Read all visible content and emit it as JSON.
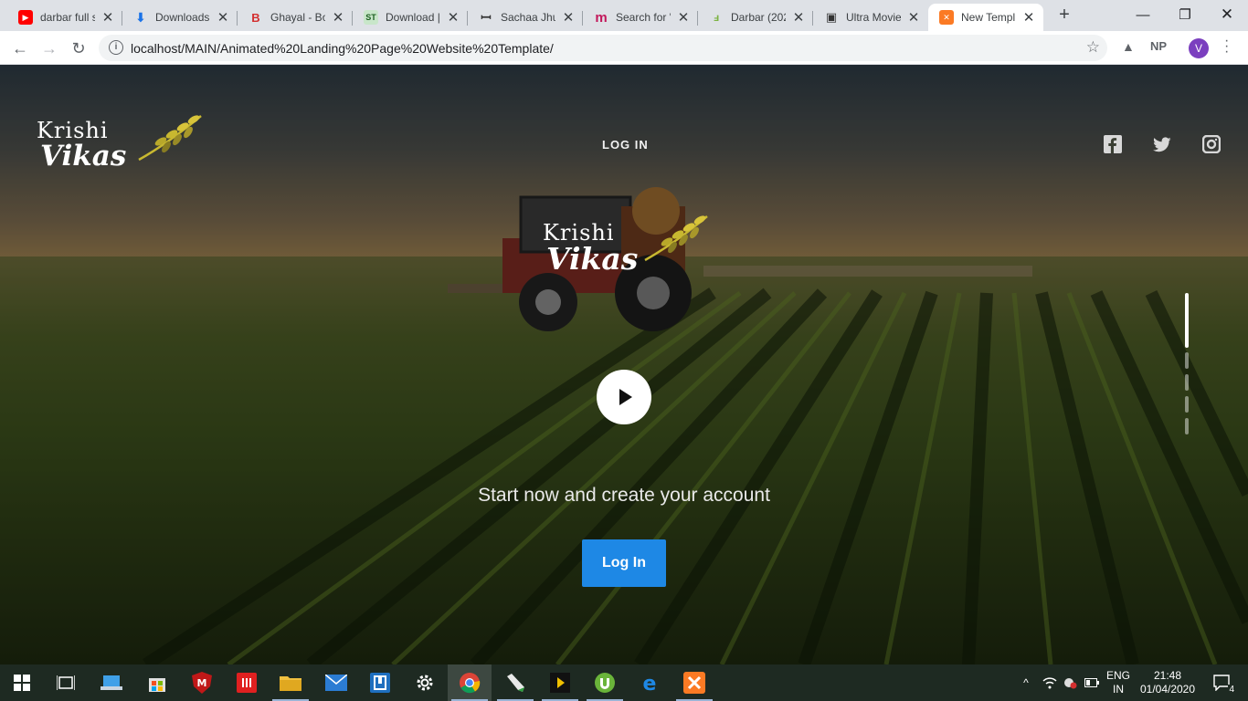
{
  "browser": {
    "tabs": [
      {
        "title": "darbar full s",
        "favicon": "youtube-icon",
        "color": "#ff0000"
      },
      {
        "title": "Downloads",
        "favicon": "download-icon",
        "color": "#1a73e8"
      },
      {
        "title": "Ghayal - Bo",
        "favicon": "bookmyshow-icon",
        "color": "#d32f2f"
      },
      {
        "title": "Download |",
        "favicon": "st-icon",
        "color": "#2e7d32"
      },
      {
        "title": "Sachaa Jhut",
        "favicon": "n-icon",
        "color": "#333333"
      },
      {
        "title": "Search for \"",
        "favicon": "m-icon",
        "color": "#c2185b"
      },
      {
        "title": "Darbar (202",
        "favicon": "darbar-icon",
        "color": "#7cb342"
      },
      {
        "title": "Ultra Movie",
        "favicon": "tv-icon",
        "color": "#333333"
      },
      {
        "title": "New Templ",
        "favicon": "xampp-icon",
        "color": "#fb7a24",
        "active": true
      }
    ],
    "url": "localhost/MAIN/Animated%20Landing%20Page%20Website%20Template/",
    "extension_label": "NP",
    "profile_initial": "V"
  },
  "site": {
    "logo": {
      "line1": "Krishi",
      "line2": "Vikas"
    },
    "nav_login": "LOG IN",
    "social": [
      "facebook-icon",
      "twitter-icon",
      "instagram-icon"
    ],
    "hero_logo": {
      "line1": "Krishi",
      "line2": "Vikas"
    },
    "tagline": "Start now and create your account",
    "cta_label": "Log In",
    "accent_color": "#1e88e5",
    "pager_total": 5,
    "pager_active": 1
  },
  "taskbar": {
    "apps": [
      "windows-start-icon",
      "task-view-icon",
      "pc-icon",
      "store-icon",
      "mcafee-icon",
      "app-red-icon",
      "file-explorer-icon",
      "mail-icon",
      "app-blue-icon",
      "settings-icon",
      "chrome-icon",
      "pen-app-icon",
      "media-player-icon",
      "utorrent-icon",
      "edge-icon",
      "xampp-icon"
    ],
    "language": "ENG",
    "region": "IN",
    "time": "21:48",
    "date": "01/04/2020",
    "notifications": "4"
  }
}
